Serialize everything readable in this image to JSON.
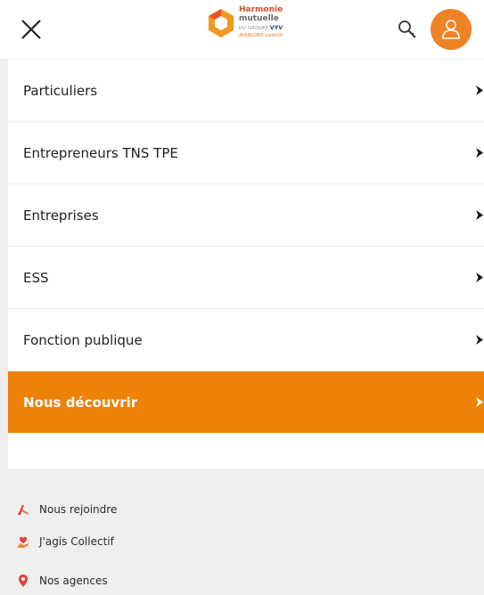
{
  "header": {
    "brand_name": "Harmonie",
    "brand_name_2": "mutuelle",
    "brand_group_prefix": "DU GROUPE",
    "brand_group": "VYV",
    "brand_tagline": "AVANÇONS collectif",
    "accent_color": "#ee8325"
  },
  "menu": {
    "items": [
      {
        "label": "Particuliers"
      },
      {
        "label": "Entrepreneurs TNS TPE"
      },
      {
        "label": "Entreprises"
      },
      {
        "label": "ESS"
      },
      {
        "label": "Fonction publique"
      },
      {
        "label": "Nous découvrir"
      }
    ],
    "active_color": "#ee8209"
  },
  "links": [
    {
      "label": "Nous rejoindre",
      "icon": "handshake-icon"
    },
    {
      "label": "J'agis Collectif",
      "icon": "heart-hand-icon"
    },
    {
      "label": "Nos agences",
      "icon": "location-pin-icon"
    }
  ]
}
